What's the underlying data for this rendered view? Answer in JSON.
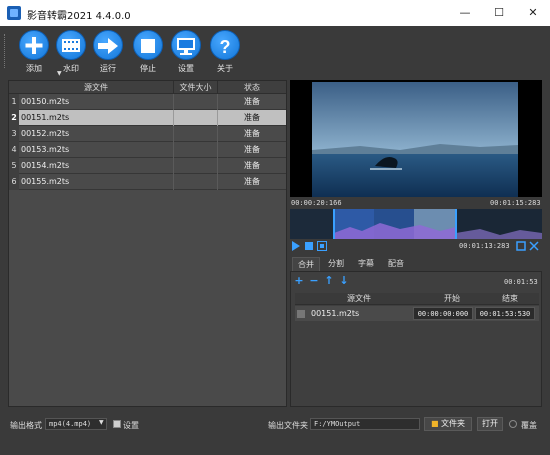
{
  "window": {
    "title": "影音转霸2021 4.4.0.0",
    "min": "—",
    "max": "☐",
    "close": "✕"
  },
  "toolbar": {
    "items": [
      {
        "label": "添加",
        "icon": "plus-icon"
      },
      {
        "label": "水印",
        "icon": "film-icon"
      },
      {
        "label": "运行",
        "icon": "arrow-right-icon"
      },
      {
        "label": "停止",
        "icon": "stop-icon"
      },
      {
        "label": "设置",
        "icon": "monitor-icon"
      },
      {
        "label": "关于",
        "icon": "question-icon"
      }
    ]
  },
  "file_table": {
    "headers": [
      "源文件",
      "文件大小",
      "状态"
    ],
    "rows": [
      {
        "num": "1",
        "file": "00150.m2ts",
        "size": "",
        "status": "准备"
      },
      {
        "num": "2",
        "file": "00151.m2ts",
        "size": "",
        "status": "准备"
      },
      {
        "num": "3",
        "file": "00152.m2ts",
        "size": "",
        "status": "准备"
      },
      {
        "num": "4",
        "file": "00153.m2ts",
        "size": "",
        "status": "准备"
      },
      {
        "num": "5",
        "file": "00154.m2ts",
        "size": "",
        "status": "准备"
      },
      {
        "num": "6",
        "file": "00155.m2ts",
        "size": "",
        "status": "准备"
      }
    ]
  },
  "player": {
    "time_start": "00:00:20:166",
    "time_end": "00:01:15:283",
    "duration": "00:01:13:283"
  },
  "tabs": [
    "合并",
    "分割",
    "字幕",
    "配音"
  ],
  "merge": {
    "duration": "00:01:53",
    "headers": [
      "源文件",
      "开始",
      "结束"
    ],
    "rows": [
      {
        "file": "00151.m2ts",
        "start": "00:00:00:000",
        "end": "00:01:53:530"
      }
    ]
  },
  "bottom": {
    "format_label": "输出格式",
    "format_value": "mp4(4.mp4)",
    "settings_label": "设置",
    "output_folder_label": "输出文件夹",
    "output_path": "F:/YMOutput",
    "folder_button": "文件夹",
    "open_button": "打开",
    "overwrite_label": "覆盖"
  },
  "colors": {
    "accent": "#1c86ee",
    "selected_row": "#c0c0c0"
  }
}
